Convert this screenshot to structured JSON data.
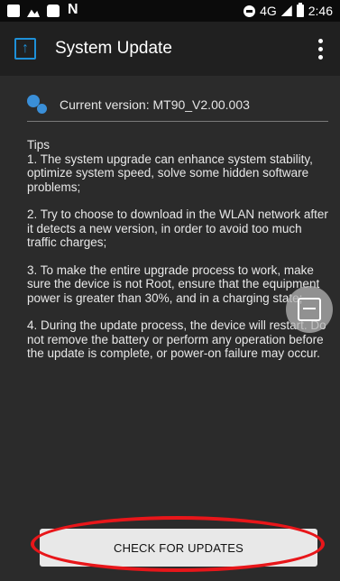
{
  "status_bar": {
    "left_icons": [
      "message-icon",
      "image-icon",
      "bag-icon",
      "nfc-icon"
    ],
    "network": "4G",
    "time": "2:46"
  },
  "app_bar": {
    "title": "System Update",
    "icon": "system-update-icon",
    "menu_icon": "more-vert-icon"
  },
  "version": {
    "icon": "gear-icon",
    "text": "Current version: MT90_V2.00.003"
  },
  "tips": {
    "title": "Tips",
    "items": [
      "1. The system upgrade can enhance system stability, optimize system speed, solve some hidden software problems;",
      "2. Try to choose to download in the WLAN network after it detects a new version, in order to avoid too much traffic charges;",
      "3. To make the entire upgrade process to work, make sure the device is not Root, ensure that the equipment power is greater than 30%, and in a charging state;",
      "4. During the update process, the device will restart. Do not remove the battery or perform any operation before the update is complete, or power-on failure may occur."
    ]
  },
  "floating_button_icon": "screenshot-icon",
  "check_button": {
    "label": "CHECK FOR UPDATES"
  },
  "colors": {
    "accent": "#1e90d8",
    "highlight": "#e8161a",
    "background": "#2b2b2b"
  }
}
